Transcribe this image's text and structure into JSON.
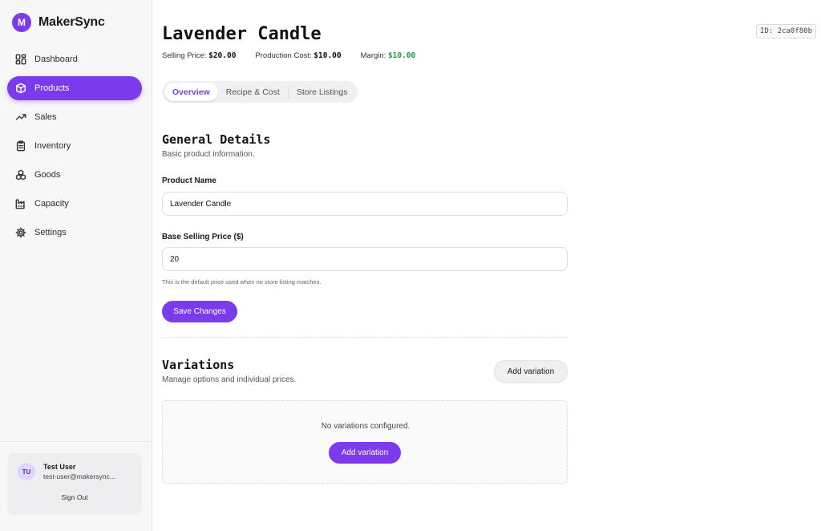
{
  "brand": {
    "logo_letter": "M",
    "name": "MakerSync",
    "accent": "#7c3aed"
  },
  "sidebar": {
    "items": [
      {
        "label": "Dashboard",
        "icon": "dashboard-grid-icon",
        "active": false
      },
      {
        "label": "Products",
        "icon": "box-icon",
        "active": true
      },
      {
        "label": "Sales",
        "icon": "trending-up-icon",
        "active": false
      },
      {
        "label": "Inventory",
        "icon": "clipboard-icon",
        "active": false
      },
      {
        "label": "Goods",
        "icon": "boxes-icon",
        "active": false
      },
      {
        "label": "Capacity",
        "icon": "factory-icon",
        "active": false
      },
      {
        "label": "Settings",
        "icon": "gear-icon",
        "active": false
      }
    ]
  },
  "user": {
    "initials": "TU",
    "name": "Test User",
    "email": "test-user@makersync...",
    "sign_out": "Sign Out"
  },
  "product": {
    "title": "Lavender Candle",
    "id_badge": "ID: 2ca0f80b",
    "selling_price_label": "Selling Price:",
    "selling_price": "$20.00",
    "production_cost_label": "Production Cost:",
    "production_cost": "$10.00",
    "margin_label": "Margin:",
    "margin": "$10.00",
    "margin_color": "#16a34a"
  },
  "tabs": [
    {
      "label": "Overview",
      "active": true
    },
    {
      "label": "Recipe & Cost",
      "active": false
    },
    {
      "label": "Store Listings",
      "active": false
    }
  ],
  "general": {
    "title": "General Details",
    "subtitle": "Basic product information.",
    "product_name_label": "Product Name",
    "product_name_value": "Lavender Candle",
    "price_label": "Base Selling Price ($)",
    "price_value": "20",
    "price_hint": "This is the default price used when no store listing matches.",
    "save_label": "Save Changes"
  },
  "variations": {
    "title": "Variations",
    "subtitle": "Manage options and individual prices.",
    "add_label": "Add variation",
    "empty_text": "No variations configured.",
    "empty_add_label": "Add variation"
  }
}
